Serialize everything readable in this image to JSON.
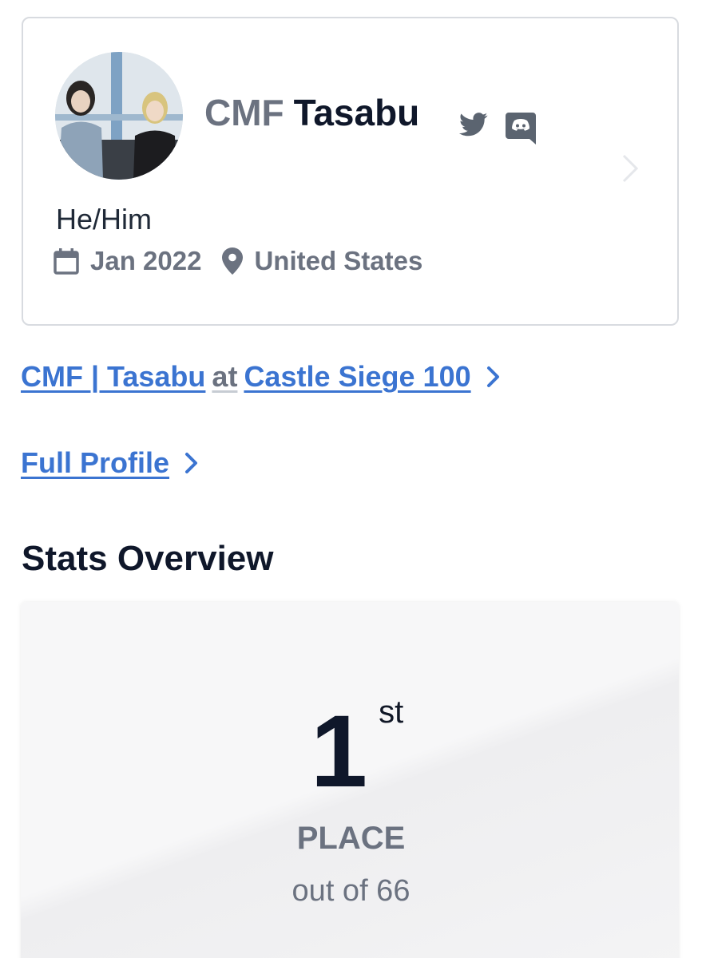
{
  "profile": {
    "prefix": "CMF",
    "handle": "Tasabu",
    "pronouns": "He/Him",
    "joined": "Jan 2022",
    "location": "United States",
    "social": [
      "twitter-icon",
      "discord-icon"
    ]
  },
  "team_link": {
    "player": "CMF | Tasabu",
    "at": "at",
    "event": "Castle Siege 100"
  },
  "full_profile_label": "Full Profile",
  "stats": {
    "title": "Stats Overview",
    "place_number": "1",
    "place_suffix": "st",
    "place_label": "PLACE",
    "out_of": "out of 66"
  },
  "colors": {
    "link": "#3b74d1",
    "muted": "#6b7280",
    "heading": "#0f172a"
  }
}
